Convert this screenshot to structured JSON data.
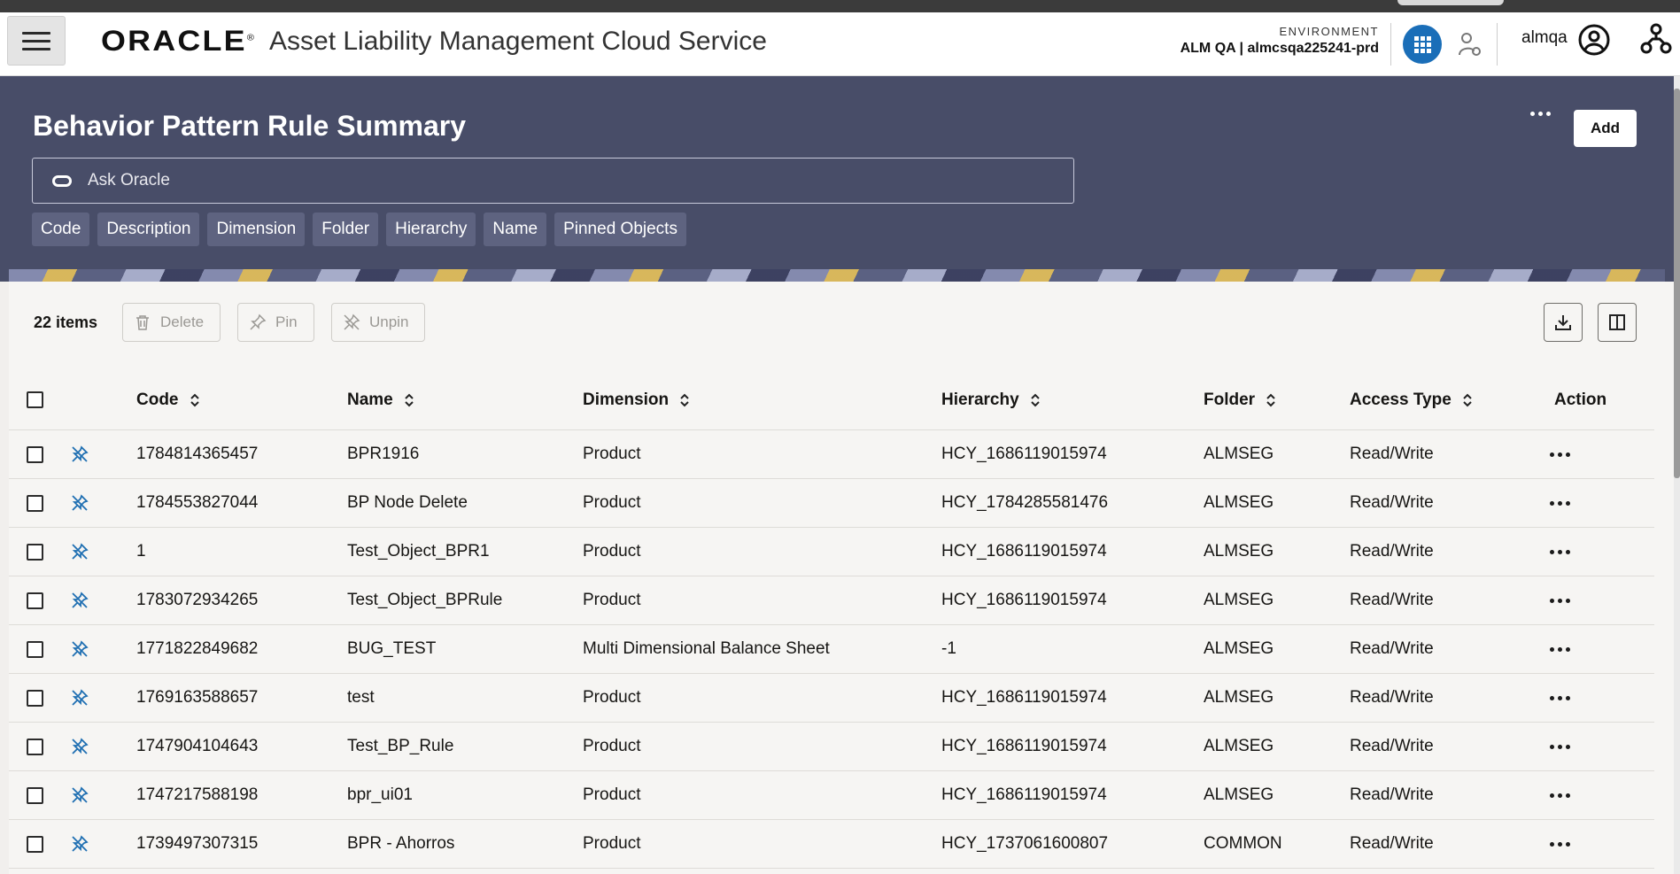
{
  "header": {
    "logo": "ORACLE",
    "logo_mark": "®",
    "app_title": "Asset Liability Management Cloud Service",
    "environment_label": "ENVIRONMENT",
    "environment_value": "ALM QA | almcsqa225241-prd",
    "user": "almqa"
  },
  "banner": {
    "title": "Behavior Pattern Rule Summary",
    "add_label": "Add",
    "ask_placeholder": "Ask Oracle",
    "chips": [
      "Code",
      "Description",
      "Dimension",
      "Folder",
      "Hierarchy",
      "Name",
      "Pinned Objects"
    ]
  },
  "toolbar": {
    "items_count": "22 items",
    "delete_label": "Delete",
    "pin_label": "Pin",
    "unpin_label": "Unpin"
  },
  "table": {
    "columns": [
      "Code",
      "Name",
      "Dimension",
      "Hierarchy",
      "Folder",
      "Access Type",
      "Action"
    ],
    "rows": [
      {
        "code": "1784814365457",
        "name": "BPR1916",
        "dimension": "Product",
        "hierarchy": "HCY_1686119015974",
        "folder": "ALMSEG",
        "access": "Read/Write"
      },
      {
        "code": "1784553827044",
        "name": "BP Node Delete",
        "dimension": "Product",
        "hierarchy": "HCY_1784285581476",
        "folder": "ALMSEG",
        "access": "Read/Write"
      },
      {
        "code": "1",
        "name": "Test_Object_BPR1",
        "dimension": "Product",
        "hierarchy": "HCY_1686119015974",
        "folder": "ALMSEG",
        "access": "Read/Write"
      },
      {
        "code": "1783072934265",
        "name": "Test_Object_BPRule",
        "dimension": "Product",
        "hierarchy": "HCY_1686119015974",
        "folder": "ALMSEG",
        "access": "Read/Write"
      },
      {
        "code": "1771822849682",
        "name": "BUG_TEST",
        "dimension": "Multi Dimensional Balance Sheet",
        "hierarchy": "-1",
        "folder": "ALMSEG",
        "access": "Read/Write"
      },
      {
        "code": "1769163588657",
        "name": "test",
        "dimension": "Product",
        "hierarchy": "HCY_1686119015974",
        "folder": "ALMSEG",
        "access": "Read/Write"
      },
      {
        "code": "1747904104643",
        "name": "Test_BP_Rule",
        "dimension": "Product",
        "hierarchy": "HCY_1686119015974",
        "folder": "ALMSEG",
        "access": "Read/Write"
      },
      {
        "code": "1747217588198",
        "name": "bpr_ui01",
        "dimension": "Product",
        "hierarchy": "HCY_1686119015974",
        "folder": "ALMSEG",
        "access": "Read/Write"
      },
      {
        "code": "1739497307315",
        "name": "BPR - Ahorros",
        "dimension": "Product",
        "hierarchy": "HCY_1737061600807",
        "folder": "COMMON",
        "access": "Read/Write"
      }
    ]
  },
  "icons": {
    "menu": "hamburger-menu-icon",
    "apps": "app-grid-icon",
    "profile": "user-circle-icon",
    "org": "hierarchy-tree-icon",
    "pinned": "unpin-icon",
    "download": "download-icon",
    "columns": "column-panel-icon"
  },
  "colors": {
    "banner": "#484d68",
    "chip": "#5e6380",
    "apps_button": "#1a6eb8",
    "pin_icon": "#1f6fb2"
  }
}
